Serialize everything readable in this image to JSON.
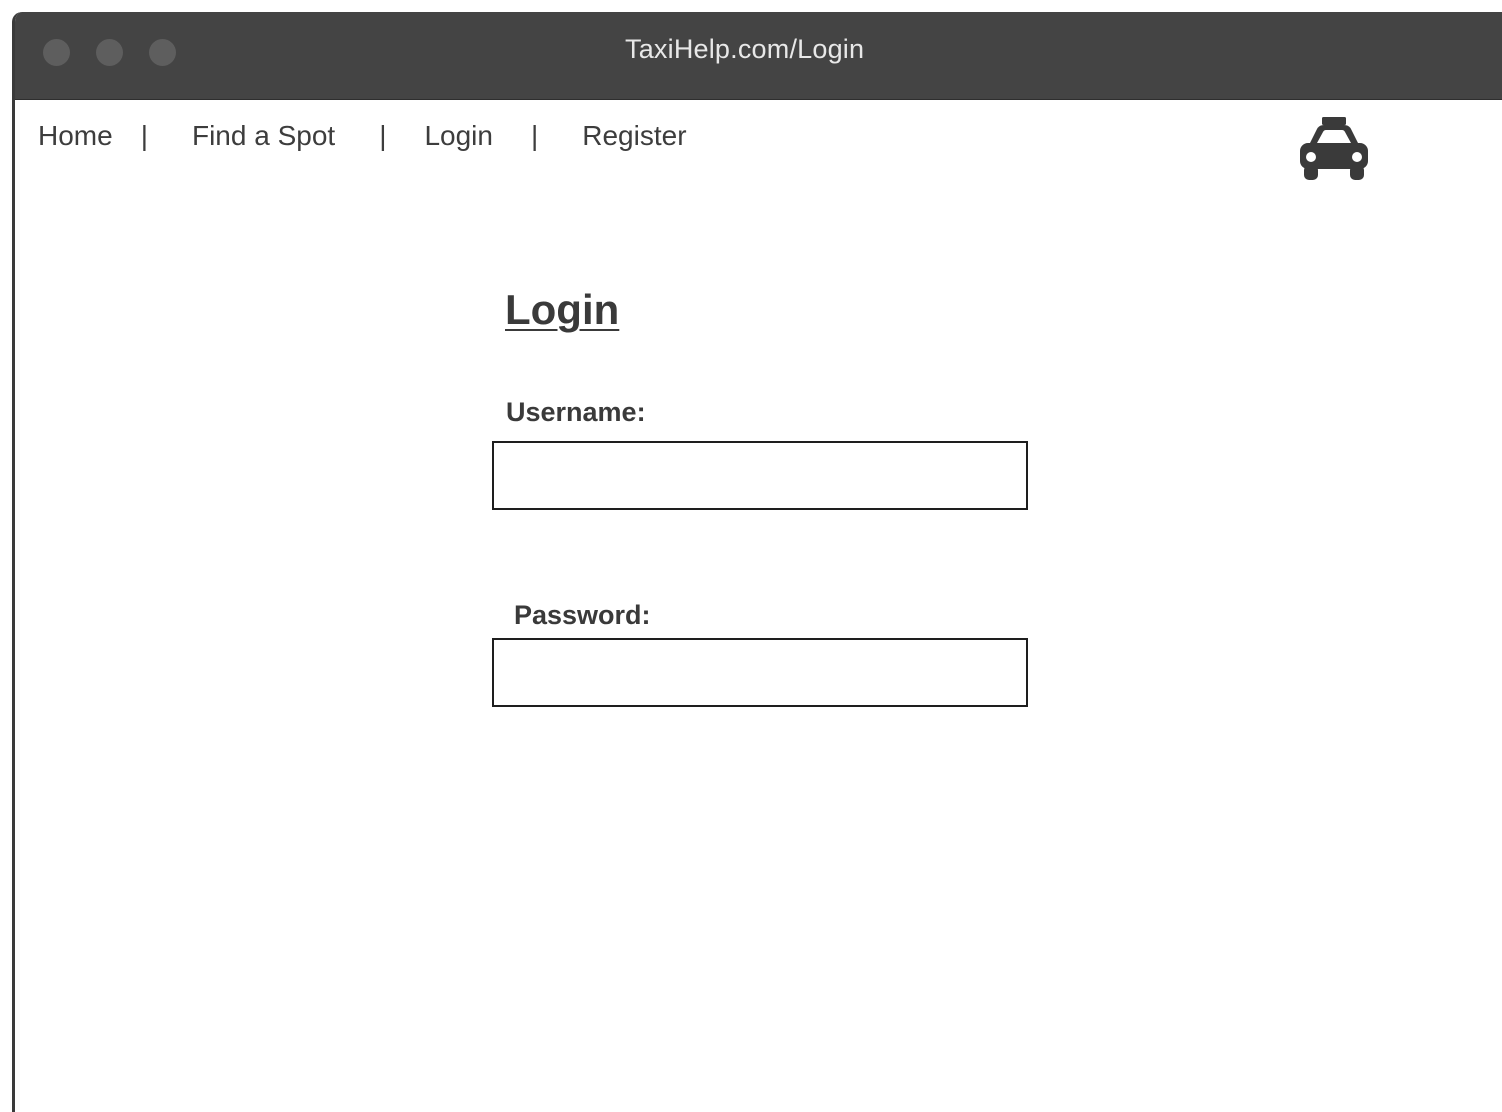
{
  "window": {
    "title": "TaxiHelp.com/Login"
  },
  "nav": {
    "items": [
      {
        "label": "Home"
      },
      {
        "label": "Find a Spot"
      },
      {
        "label": "Login"
      },
      {
        "label": "Register"
      }
    ],
    "separator": "|",
    "logo_icon": "taxi-icon"
  },
  "form": {
    "title": "Login",
    "username_label": "Username:",
    "username_value": "",
    "password_label": "Password:",
    "password_value": ""
  },
  "colors": {
    "titlebar": "#444444",
    "title_text": "#e8e8e8",
    "text": "#3d3d3d",
    "input_border": "#1e1e1e"
  }
}
